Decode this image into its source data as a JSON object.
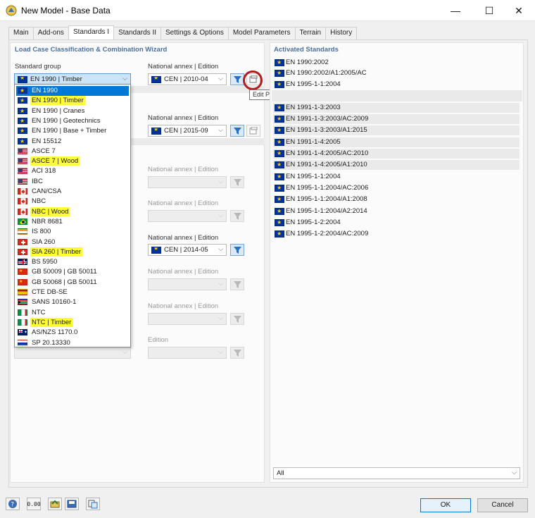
{
  "window": {
    "title": "New Model - Base Data",
    "minimize": "—",
    "maximize": "☐",
    "close": "✕"
  },
  "tabs": [
    "Main",
    "Add-ons",
    "Standards I",
    "Standards II",
    "Settings & Options",
    "Model Parameters",
    "Terrain",
    "History"
  ],
  "active_tab": "Standards I",
  "left": {
    "title": "Load Case Classification & Combination Wizard",
    "standard_group_label": "Standard group",
    "standard_group_value": "EN 1990 | Timber",
    "national_annex_label": "National annex | Edition",
    "edition_label": "Edition",
    "na_value_1": "CEN | 2010-04",
    "na_value_2": "CEN | 2015-09",
    "na_value_5": "CEN | 2014-05",
    "tooltip": "Edit Parameters of National Annex | Edition"
  },
  "dropdown_items": [
    {
      "label": "EN 1990",
      "flag": "eu",
      "selected": true,
      "hl": false
    },
    {
      "label": "EN 1990 | Timber",
      "flag": "eu",
      "selected": false,
      "hl": true
    },
    {
      "label": "EN 1990 | Cranes",
      "flag": "eu",
      "selected": false,
      "hl": false
    },
    {
      "label": "EN 1990 | Geotechnics",
      "flag": "eu",
      "selected": false,
      "hl": false
    },
    {
      "label": "EN 1990 | Base + Timber",
      "flag": "eu",
      "selected": false,
      "hl": false
    },
    {
      "label": "EN 15512",
      "flag": "eu",
      "selected": false,
      "hl": false
    },
    {
      "label": "ASCE 7",
      "flag": "us",
      "selected": false,
      "hl": false
    },
    {
      "label": "ASCE 7 | Wood",
      "flag": "us",
      "selected": false,
      "hl": true
    },
    {
      "label": "ACI 318",
      "flag": "us",
      "selected": false,
      "hl": false
    },
    {
      "label": "IBC",
      "flag": "us",
      "selected": false,
      "hl": false
    },
    {
      "label": "CAN/CSA",
      "flag": "ca",
      "selected": false,
      "hl": false
    },
    {
      "label": "NBC",
      "flag": "ca",
      "selected": false,
      "hl": false
    },
    {
      "label": "NBC | Wood",
      "flag": "ca",
      "selected": false,
      "hl": true
    },
    {
      "label": "NBR 8681",
      "flag": "br",
      "selected": false,
      "hl": false
    },
    {
      "label": "IS 800",
      "flag": "in",
      "selected": false,
      "hl": false
    },
    {
      "label": "SIA 260",
      "flag": "ch",
      "selected": false,
      "hl": false
    },
    {
      "label": "SIA 260 | Timber",
      "flag": "ch",
      "selected": false,
      "hl": true
    },
    {
      "label": "BS 5950",
      "flag": "gb",
      "selected": false,
      "hl": false
    },
    {
      "label": "GB 50009 | GB 50011",
      "flag": "cn",
      "selected": false,
      "hl": false
    },
    {
      "label": "GB 50068 | GB 50011",
      "flag": "cn",
      "selected": false,
      "hl": false
    },
    {
      "label": "CTE DB-SE",
      "flag": "es",
      "selected": false,
      "hl": false
    },
    {
      "label": "SANS 10160-1",
      "flag": "za",
      "selected": false,
      "hl": false
    },
    {
      "label": "NTC",
      "flag": "it",
      "selected": false,
      "hl": false
    },
    {
      "label": "NTC | Timber",
      "flag": "it",
      "selected": false,
      "hl": true
    },
    {
      "label": "AS/NZS 1170.0",
      "flag": "au",
      "selected": false,
      "hl": false
    },
    {
      "label": "SP 20.13330",
      "flag": "ru",
      "selected": false,
      "hl": false
    }
  ],
  "right": {
    "title": "Activated Standards",
    "standards": [
      "EN 1990:2002",
      "EN 1990:2002/A1:2005/AC",
      "EN 1995-1-1:2004",
      "EN 1991-1-3:2003",
      "EN 1991-1-3:2003/AC:2009",
      "EN 1991-1-3:2003/A1:2015",
      "EN 1991-1-4:2005",
      "EN 1991-1-4:2005/AC:2010",
      "EN 1991-1-4:2005/A1:2010",
      "EN 1995-1-1:2004",
      "EN 1995-1-1:2004/AC:2006",
      "EN 1995-1-1:2004/A1:2008",
      "EN 1995-1-1:2004/A2:2014",
      "EN 1995-1-2:2004",
      "EN 1995-1-2:2004/AC:2009"
    ],
    "filter_value": "All"
  },
  "footer": {
    "ok": "OK",
    "cancel": "Cancel",
    "units_icon_text": "0.00"
  }
}
